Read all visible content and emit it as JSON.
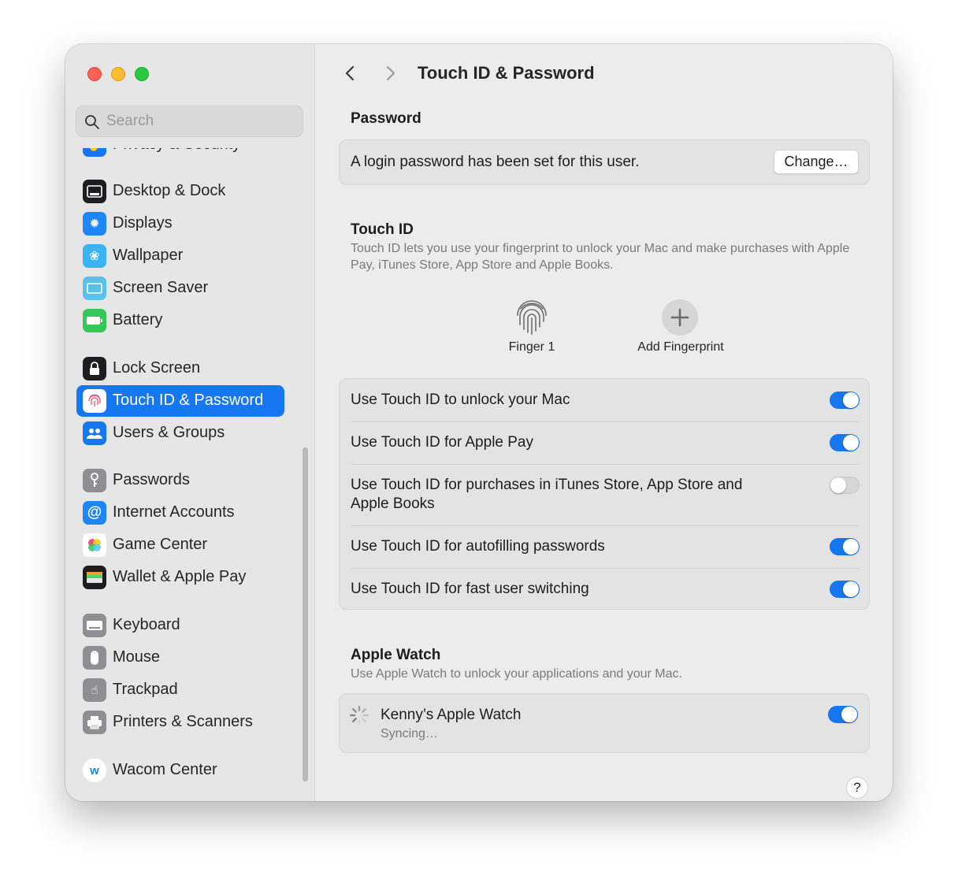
{
  "window": {
    "title": "Touch ID & Password"
  },
  "search": {
    "placeholder": "Search"
  },
  "sidebar": {
    "items": [
      {
        "label": "Privacy & Security",
        "icon": "hand-icon",
        "color": "#1677f3"
      },
      {
        "label": "Desktop & Dock",
        "icon": "dock-icon",
        "color": "#1d1d1f"
      },
      {
        "label": "Displays",
        "icon": "sun-icon",
        "color": "#1f86f5"
      },
      {
        "label": "Wallpaper",
        "icon": "flower-icon",
        "color": "#39b3f1"
      },
      {
        "label": "Screen Saver",
        "icon": "screen-icon",
        "color": "#5ac1e8"
      },
      {
        "label": "Battery",
        "icon": "battery-icon",
        "color": "#34c759"
      },
      {
        "label": "Lock Screen",
        "icon": "lock-icon",
        "color": "#1d1d1f"
      },
      {
        "label": "Touch ID & Password",
        "icon": "fingerprint-icon",
        "color": "#ffffff",
        "selected": true
      },
      {
        "label": "Users & Groups",
        "icon": "users-icon",
        "color": "#1677f3"
      },
      {
        "label": "Passwords",
        "icon": "key-icon",
        "color": "#8e8e93"
      },
      {
        "label": "Internet Accounts",
        "icon": "at-icon",
        "color": "#1f86f5"
      },
      {
        "label": "Game Center",
        "icon": "game-center-icon",
        "color": "#ffffff"
      },
      {
        "label": "Wallet & Apple Pay",
        "icon": "wallet-icon",
        "color": "#1d1d1f"
      },
      {
        "label": "Keyboard",
        "icon": "keyboard-icon",
        "color": "#8e8e93"
      },
      {
        "label": "Mouse",
        "icon": "mouse-icon",
        "color": "#8e8e93"
      },
      {
        "label": "Trackpad",
        "icon": "trackpad-icon",
        "color": "#8e8e93"
      },
      {
        "label": "Printers & Scanners",
        "icon": "printer-icon",
        "color": "#8e8e93"
      },
      {
        "label": "Wacom Center",
        "icon": "wacom-icon",
        "color": "#ffffff"
      }
    ]
  },
  "password_section": {
    "heading": "Password",
    "status": "A login password has been set for this user.",
    "change_button": "Change…"
  },
  "touch_id": {
    "heading": "Touch ID",
    "description": "Touch ID lets you use your fingerprint to unlock your Mac and make purchases with Apple Pay, iTunes Store, App Store and Apple Books.",
    "finger_label": "Finger 1",
    "add_label": "Add Fingerprint",
    "options": [
      {
        "label": "Use Touch ID to unlock your Mac",
        "on": true
      },
      {
        "label": "Use Touch ID for Apple Pay",
        "on": true
      },
      {
        "label": "Use Touch ID for purchases in iTunes Store, App Store and Apple Books",
        "on": false
      },
      {
        "label": "Use Touch ID for autofilling passwords",
        "on": true
      },
      {
        "label": "Use Touch ID for fast user switching",
        "on": true
      }
    ]
  },
  "apple_watch": {
    "heading": "Apple Watch",
    "description": "Use Apple Watch to unlock your applications and your Mac.",
    "device_name": "Kenny’s Apple Watch",
    "device_status": "Syncing…",
    "on": true
  },
  "help": {
    "label": "?"
  },
  "colors": {
    "accent": "#1677f3"
  }
}
